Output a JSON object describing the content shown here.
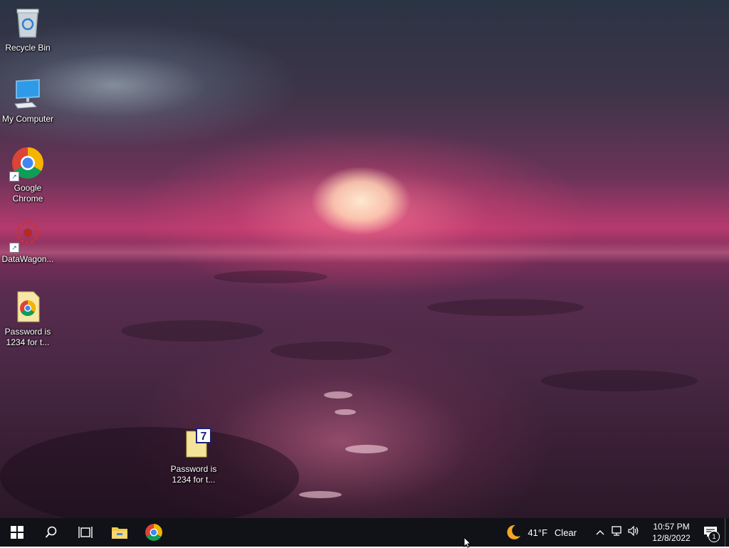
{
  "desktop": {
    "icons": [
      {
        "label": "Recycle Bin",
        "icon": "recycle-bin-icon"
      },
      {
        "label": "My Computer",
        "icon": "computer-icon"
      },
      {
        "label": "Google Chrome",
        "icon": "chrome-icon"
      },
      {
        "label": "DataWagon...",
        "icon": "datawagon-icon"
      },
      {
        "label": "Password is 1234 for t...",
        "icon": "chrome-document-icon"
      },
      {
        "label": "Password is 1234 for t...",
        "icon": "7zip-archive-icon"
      }
    ]
  },
  "taskbar": {
    "buttons": [
      "windows-start-icon",
      "search-icon",
      "task-view-icon",
      "file-explorer-icon",
      "chrome-icon"
    ],
    "weather": {
      "temperature": "41°F",
      "condition": "Clear",
      "icon": "moon-icon"
    },
    "tray_icons": [
      "chevron-up-icon",
      "network-icon",
      "volume-icon"
    ],
    "clock": {
      "time": "10:57 PM",
      "date": "12/8/2022"
    },
    "notifications": {
      "count": "1",
      "icon": "action-center-icon"
    }
  },
  "colors": {
    "taskbar": "#101217",
    "accent_folder": "#f3d36b",
    "chrome_red": "#db4437",
    "chrome_green": "#0f9d58",
    "chrome_yellow": "#f4b400",
    "chrome_blue": "#4285f4"
  }
}
